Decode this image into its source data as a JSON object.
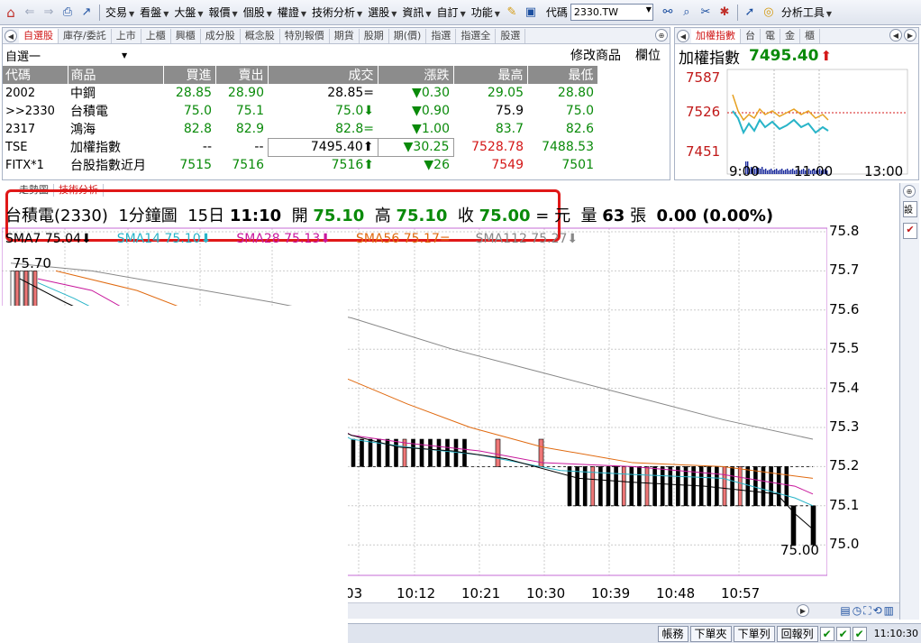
{
  "toolbar": {
    "menus": [
      "交易",
      "看盤",
      "大盤",
      "報價",
      "個股",
      "權證",
      "技術分析",
      "選股",
      "資訊",
      "自訂",
      "功能"
    ],
    "code_label": "代碼",
    "code_value": "2330.TW",
    "tool_menu": "分析工具"
  },
  "quote_panel": {
    "tabs": [
      "自選股",
      "庫存/委託",
      "上市",
      "上櫃",
      "興櫃",
      "成分股",
      "概念股",
      "特別報價",
      "期貨",
      "股期",
      "期(價)",
      "指選",
      "指選全",
      "股選"
    ],
    "selector": "自選一",
    "modify_btn": "修改商品",
    "field_btn": "欄位",
    "headers": [
      "代碼",
      "商品",
      "買進",
      "賣出",
      "成交",
      "漲跌",
      "最高",
      "最低"
    ],
    "rows": [
      {
        "code": "2002",
        "name": "中鋼",
        "bid": "28.85",
        "ask": "28.90",
        "last": "28.85=",
        "chg": "▼0.30",
        "high": "29.05",
        "low": "28.80"
      },
      {
        "code": ">>2330",
        "name": "台積電",
        "bid": "75.0",
        "ask": "75.1",
        "last": "75.0⬇",
        "chg": "▼0.90",
        "high": "75.9",
        "low": "75.0"
      },
      {
        "code": "2317",
        "name": "鴻海",
        "bid": "82.8",
        "ask": "82.9",
        "last": "82.8=",
        "chg": "▼1.00",
        "high": "83.7",
        "low": "82.6"
      },
      {
        "code": "TSE",
        "name": "加權指數",
        "bid": "--",
        "ask": "--",
        "last": "7495.40⬆",
        "chg": "▼30.25",
        "high": "7528.78",
        "low": "7488.53"
      },
      {
        "code": "FITX*1",
        "name": "台股指數近月",
        "bid": "7515",
        "ask": "7516",
        "last": "7516⬆",
        "chg": "▼26",
        "high": "7549",
        "low": "7501"
      }
    ]
  },
  "index_panel": {
    "tabs": [
      "加權指數",
      "台",
      "電",
      "金",
      "櫃"
    ],
    "name": "加權指數",
    "value": "7495.40",
    "arrow": "⬆",
    "y_labels": [
      "7587",
      "7526",
      "7451"
    ],
    "x_labels": [
      "9:00",
      "11:00",
      "13:00"
    ]
  },
  "chart": {
    "tabs": [
      "走勢圖",
      "技術分析"
    ],
    "stock": "台積電(2330)",
    "period": "1分鐘圖",
    "date": "15日",
    "time": "11:10",
    "open_label": "開",
    "open": "75.10",
    "high_label": "高",
    "high": "75.10",
    "close_label": "收",
    "close": "75.00",
    "eq": "=",
    "unit": "元",
    "vol_label": "量",
    "vol": "63",
    "vol_unit": "張",
    "change": "0.00 (0.00%)",
    "sma": [
      {
        "label": "SMA7 75.04⬇",
        "color": "#000000"
      },
      {
        "label": "SMA14 75.10⬇",
        "color": "#28b4c8"
      },
      {
        "label": "SMA28 75.13⬇",
        "color": "#c8189c"
      },
      {
        "label": "SMA56 75.17=",
        "color": "#e06a10"
      },
      {
        "label": "SMA112 75.27⬇",
        "color": "#888888"
      }
    ],
    "y_ticks": [
      "75.8",
      "75.7",
      "75.6",
      "75.5",
      "75.4",
      "75.3",
      "75.2",
      "75.1",
      "75.0"
    ],
    "x_ticks": [
      ":03",
      "10:12",
      "10:21",
      "10:30",
      "10:39",
      "10:48",
      "10:57"
    ],
    "max_label": "75.70",
    "min_label": "75.00"
  },
  "status": {
    "buttons": [
      "帳務",
      "下單夾",
      "下單列",
      "回報列"
    ],
    "clock": "11:10:30"
  },
  "chart_data": {
    "type": "candlestick",
    "title": "台積電(2330) 1分鐘圖",
    "ylim": [
      75.0,
      75.8
    ],
    "x_ticks": [
      ":03",
      "10:12",
      "10:21",
      "10:30",
      "10:39",
      "10:48",
      "10:57"
    ],
    "series": [
      {
        "name": "SMA7",
        "last": 75.04
      },
      {
        "name": "SMA14",
        "last": 75.1
      },
      {
        "name": "SMA28",
        "last": 75.13
      },
      {
        "name": "SMA56",
        "last": 75.17
      },
      {
        "name": "SMA112",
        "last": 75.27
      }
    ]
  }
}
